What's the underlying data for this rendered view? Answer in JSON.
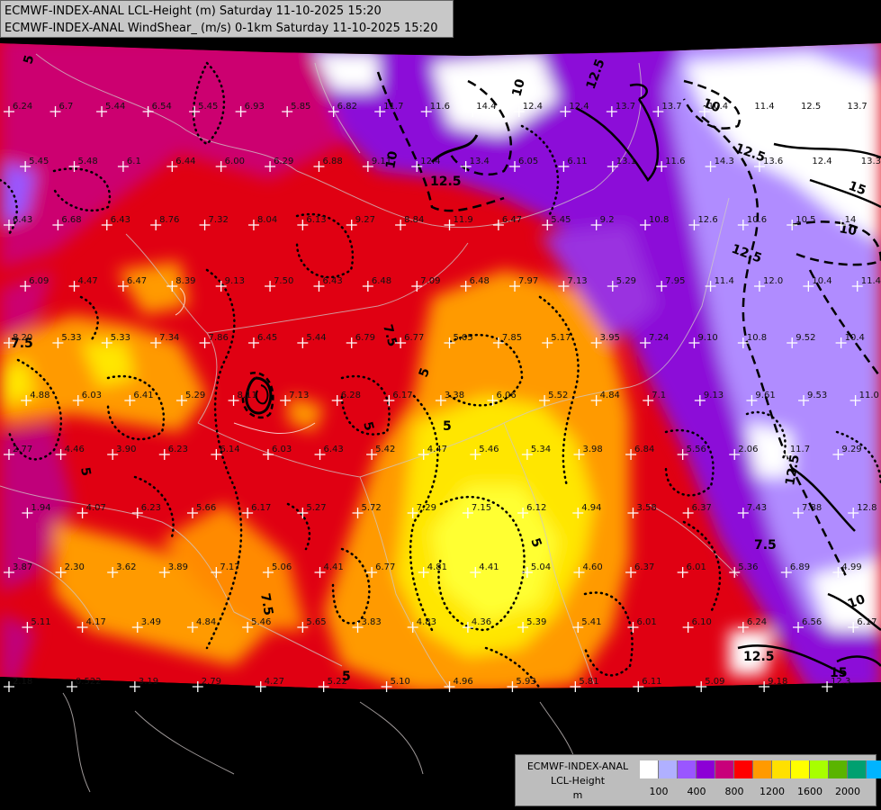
{
  "header": {
    "line1": "ECMWF-INDEX-ANAL LCL-Height (m) Saturday 11-10-2025 15:20",
    "line2": "ECMWF-INDEX-ANAL WindShear_ (m/s) 0-1km Saturday 11-10-2025 15:20"
  },
  "legend": {
    "line1": "ECMWF-INDEX-ANAL",
    "line2": "LCL-Height",
    "line3": "m",
    "colors": [
      "#ffffff",
      "#b0b0ff",
      "#9a56ff",
      "#8c00d6",
      "#c8007a",
      "#ff0000",
      "#ff9a00",
      "#ffe000",
      "#ffff00",
      "#a8ff00",
      "#5ab400",
      "#00a070",
      "#00b4ff"
    ],
    "ticks": [
      "100",
      "400",
      "800",
      "1200",
      "1600",
      "2000"
    ]
  },
  "contour_labels": [
    "5",
    "10",
    "12.5",
    "15",
    "7.5"
  ],
  "station_values": [
    "6.24",
    "6.7",
    "5.44",
    "6.54",
    "5.45",
    "6.93",
    "5.85",
    "6.82",
    "11.7",
    "11.6",
    "14.4",
    "12.4",
    "12.4",
    "13.7",
    "13.7",
    "10.4",
    "11.4",
    "12.5",
    "13.7",
    "5.45",
    "5.48",
    "6.1",
    "6.44",
    "6.00",
    "6.29",
    "6.88",
    "9.11",
    "12.4",
    "13.4",
    "6.05",
    "6.11",
    "13.1",
    "11.6",
    "14.3",
    "13.6",
    "12.4",
    "13.3",
    "6.43",
    "6.68",
    "6.43",
    "8.76",
    "7.32",
    "8.04",
    "6.13",
    "9.27",
    "8.84",
    "11.9",
    "6.47",
    "5.45",
    "9.2",
    "10.8",
    "12.6",
    "10.6",
    "10.5",
    "14",
    "6.09",
    "4.47",
    "6.47",
    "8.39",
    "9.13",
    "7.50",
    "6.43",
    "6.48",
    "7.09",
    "6.48",
    "7.97",
    "7.13",
    "5.29",
    "7.95",
    "11.4",
    "12.0",
    "10.4",
    "11.4",
    "8.20",
    "5.33",
    "5.33",
    "7.34",
    "7.86",
    "6.45",
    "5.44",
    "6.79",
    "6.77",
    "5.05",
    "7.85",
    "5.17",
    "3.95",
    "7.24",
    "9.10",
    "10.8",
    "9.52",
    "10.4",
    "4.88",
    "6.03",
    "6.41",
    "5.29",
    "8.11",
    "7.13",
    "6.28",
    "6.17",
    "3.38",
    "6.06",
    "5.52",
    "4.84",
    "7.1",
    "9.13",
    "9.61",
    "9.53",
    "11.0",
    "2.77",
    "4.46",
    "3.90",
    "6.23",
    "6.14",
    "6.03",
    "6.43",
    "5.42",
    "4.47",
    "5.46",
    "5.34",
    "3.98",
    "6.84",
    "5.56",
    "2.06",
    "11.7",
    "9.29",
    "1.94",
    "4.07",
    "6.23",
    "5.66",
    "6.17",
    "5.27",
    "5.72",
    "7.29",
    "7.15",
    "6.12",
    "4.94",
    "3.58",
    "6.37",
    "7.43",
    "7.88",
    "12.8",
    "3.87",
    "2.30",
    "3.62",
    "3.89",
    "7.17",
    "5.06",
    "4.41",
    "6.77",
    "4.81",
    "4.41",
    "5.04",
    "4.60",
    "6.37",
    "6.01",
    "5.36",
    "6.89",
    "4.99",
    "5.11",
    "4.17",
    "3.49",
    "4.84",
    "5.46",
    "5.65",
    "3.83",
    "4.83",
    "4.36",
    "5.39",
    "5.41",
    "6.01",
    "6.10",
    "6.24",
    "6.56",
    "6.17",
    "2.18",
    "0.522",
    "3.19",
    "2.79",
    "4.27",
    "5.22",
    "5.10",
    "4.96",
    "5.93",
    "5.81",
    "6.11",
    "5.09",
    "9.18",
    "12.3"
  ]
}
